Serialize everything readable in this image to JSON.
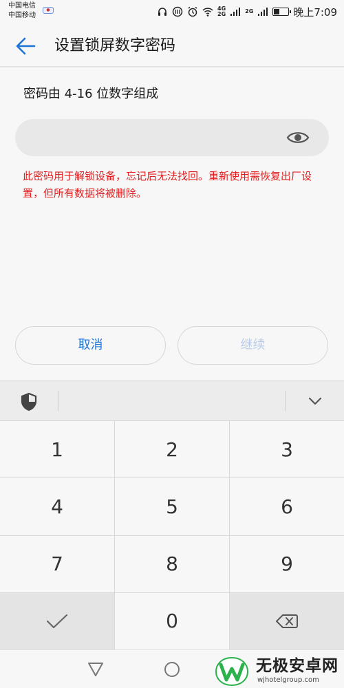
{
  "status_bar": {
    "carrier_1": "中国电信",
    "carrier_2": "中国移动",
    "network_1": "4G",
    "network_2": "2G",
    "network_3": "2G",
    "time": "晚上7:09",
    "battery_level": 0.4
  },
  "header": {
    "title": "设置锁屏数字密码"
  },
  "instruction": "密码由 4-16 位数字组成",
  "password": {
    "value": "",
    "placeholder": ""
  },
  "warning": "此密码用于解锁设备，忘记后无法找回。重新使用需恢复出厂设置，但所有数据将被删除。",
  "buttons": {
    "cancel_label": "取消",
    "continue_label": "继续"
  },
  "keypad": {
    "keys": [
      "1",
      "2",
      "3",
      "4",
      "5",
      "6",
      "7",
      "8",
      "9",
      "",
      "0",
      ""
    ]
  },
  "watermark": {
    "name": "无极安卓网",
    "domain": "wjhotelgroup.com"
  },
  "colors": {
    "accent": "#1e74d6",
    "warning": "#e02020",
    "disabled": "#b7cbe8",
    "watermark_green": "#2bb24c"
  },
  "icons": {
    "back": "arrow-left-icon",
    "eye": "eye-icon",
    "shield": "shield-icon",
    "collapse": "chevron-down-icon",
    "confirm": "checkmark-icon",
    "delete": "backspace-icon",
    "nav_back": "triangle-back-icon",
    "nav_home": "circle-home-icon"
  }
}
